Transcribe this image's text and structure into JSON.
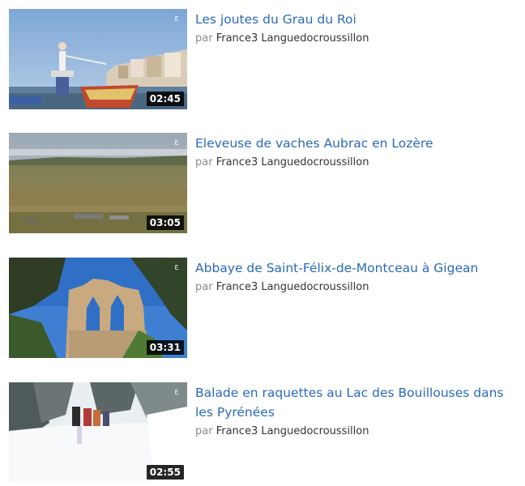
{
  "videos": [
    {
      "title": "Les joutes du Grau du Roi",
      "by": "par",
      "author": "France3 Languedocroussillon",
      "duration": "02:45",
      "channel_mark": "ε"
    },
    {
      "title": "Eleveuse de vaches Aubrac en Lozère",
      "by": "par",
      "author": "France3 Languedocroussillon",
      "duration": "03:05",
      "channel_mark": "ε"
    },
    {
      "title": "Abbaye de Saint-Félix-de-Montceau à Gigean",
      "by": "par",
      "author": "France3 Languedocroussillon",
      "duration": "03:31",
      "channel_mark": "ε"
    },
    {
      "title": "Balade en raquettes au Lac des Bouillouses dans les Pyrénées",
      "by": "par",
      "author": "France3 Languedocroussillon",
      "duration": "02:55",
      "channel_mark": "ε"
    }
  ],
  "colors": {
    "link": "#2a6aba",
    "byline": "#888888",
    "author": "#333333"
  }
}
